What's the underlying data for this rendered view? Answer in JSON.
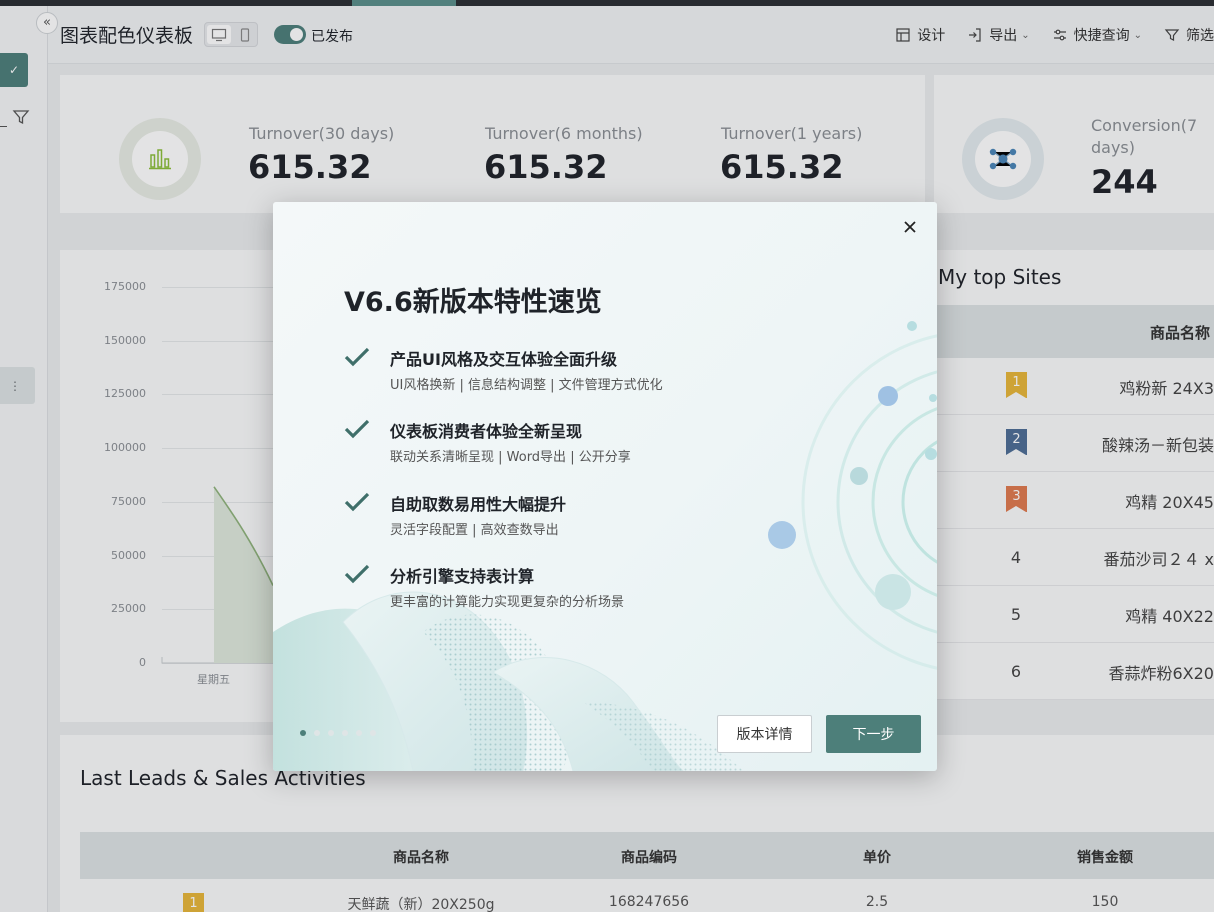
{
  "header": {
    "title": "图表配色仪表板",
    "published_label": "已发布",
    "toolbar": [
      {
        "label": "设计",
        "icon": "design-icon",
        "dropdown": false
      },
      {
        "label": "导出",
        "icon": "export-icon",
        "dropdown": true
      },
      {
        "label": "快捷查询",
        "icon": "quick-query-icon",
        "dropdown": true
      },
      {
        "label": "筛选",
        "icon": "filter-icon",
        "dropdown": false
      }
    ]
  },
  "kpis": [
    {
      "label": "Turnover(30 days)",
      "value": "615.32"
    },
    {
      "label": "Turnover(6 months)",
      "value": "615.32"
    },
    {
      "label": "Turnover(1 years)",
      "value": "615.32"
    }
  ],
  "conversion": {
    "label_line1": "Conversion(7",
    "label_line2": "days)",
    "value": "244"
  },
  "chart_data": {
    "type": "area",
    "title": "",
    "xlabel": "",
    "ylabel": "",
    "ylim": [
      0,
      175000
    ],
    "yticks": [
      "175000",
      "150000",
      "125000",
      "100000",
      "75000",
      "50000",
      "25000",
      "0"
    ],
    "x": [
      "星期五"
    ],
    "series": [
      {
        "values": [
          82000
        ]
      }
    ]
  },
  "top_sites": {
    "title": "My top Sites",
    "column": "商品名称",
    "rows": [
      {
        "rank": "1",
        "name": "鸡粉新 24X3"
      },
      {
        "rank": "2",
        "name": "酸辣汤－新包装"
      },
      {
        "rank": "3",
        "name": "鸡精 20X45"
      },
      {
        "rank": "4",
        "name": "番茄沙司２４ x"
      },
      {
        "rank": "5",
        "name": "鸡精 40X22"
      },
      {
        "rank": "6",
        "name": "香蒜炸粉6X20"
      }
    ],
    "badge_colors": [
      "#e8b73a",
      "#4e6e96",
      "#e07a4f"
    ]
  },
  "leads": {
    "title": "Last Leads & Sales Activities",
    "columns": [
      "商品名称",
      "商品编码",
      "单价",
      "销售金额"
    ],
    "first_row": {
      "rank": "1",
      "name": "天鲜蔬（新）20X250g",
      "code": "168247656",
      "price": "2.5",
      "amount": "150"
    }
  },
  "modal": {
    "title": "V6.6新版本特性速览",
    "features": [
      {
        "title": "产品UI风格及交互体验全面升级",
        "subtitle": "UI风格换新 | 信息结构调整 | 文件管理方式优化"
      },
      {
        "title": "仪表板消费者体验全新呈现",
        "subtitle": "联动关系清晰呈现 | Word导出 | 公开分享"
      },
      {
        "title": "自助取数易用性大幅提升",
        "subtitle": "灵活字段配置 | 高效查数导出"
      },
      {
        "title": "分析引擎支持表计算",
        "subtitle": "更丰富的计算能力实现更复杂的分析场景"
      }
    ],
    "detail_button": "版本详情",
    "next_button": "下一步",
    "page_dots": 6,
    "active_dot": 0
  },
  "colors": {
    "accent": "#4d7f7a",
    "check": "#3f6f6a"
  }
}
